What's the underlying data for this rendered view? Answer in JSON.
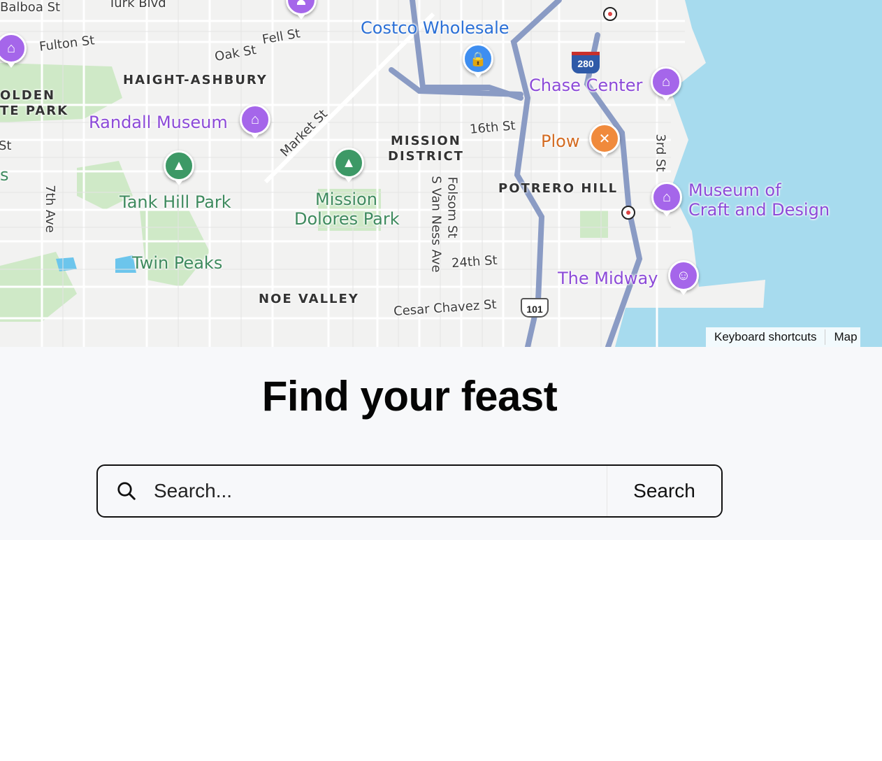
{
  "map": {
    "streets": [
      "Balboa St",
      "Turk Blvd",
      "Fulton St",
      "Fell St",
      "Oak St",
      "Market St",
      "16th St",
      "3rd St",
      "7th Ave",
      "S Van Ness Ave",
      "Folsom St",
      "24th St",
      "Cesar Chavez St"
    ],
    "districts": [
      "HAIGHT-ASHBURY",
      "OLDEN",
      "TE PARK",
      "MISSION",
      "DISTRICT",
      "POTRERO HILL",
      "NOE VALLEY"
    ],
    "places": {
      "costco": "Costco Wholesale",
      "chase": "Chase Center",
      "randall": "Randall Museum",
      "plow": "Plow",
      "tank_hill": "Tank Hill Park",
      "mission_dolores_1": "Mission",
      "mission_dolores_2": "Dolores Park",
      "museum_1": "Museum of",
      "museum_2": "Craft and Design",
      "twin_peaks": "Twin Peaks",
      "midway": "The Midway"
    },
    "shields": {
      "i280": "280",
      "us101": "101"
    },
    "edge_fragments": {
      "st": "St",
      "s": "s"
    },
    "attribution": {
      "shortcuts": "Keyboard shortcuts",
      "map": "Map"
    },
    "colors": {
      "water": "#a7dbee",
      "park": "#cfe9c7",
      "highway": "#8a9bc4"
    }
  },
  "page": {
    "title": "Find your feast",
    "search": {
      "placeholder": "Search...",
      "value": "",
      "button": "Search"
    }
  }
}
